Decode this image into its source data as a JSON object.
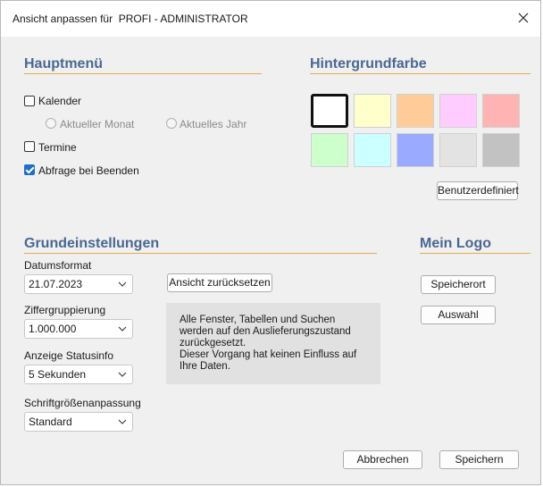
{
  "window": {
    "title": "Ansicht anpassen für  PROFI - ADMINISTRATOR"
  },
  "hauptmenu": {
    "title": "Hauptmenü",
    "kalender": {
      "label": "Kalender",
      "checked": false
    },
    "aktueller_monat": {
      "label": "Aktueller Monat"
    },
    "aktuelles_jahr": {
      "label": "Aktuelles Jahr"
    },
    "termine": {
      "label": "Termine",
      "checked": false
    },
    "abfrage": {
      "label": "Abfrage bei Beenden",
      "checked": true
    }
  },
  "hintergrund": {
    "title": "Hintergrundfarbe",
    "swatches": [
      "#ffffff",
      "#ffffcc",
      "#ffcc99",
      "#ffccff",
      "#ffb3b3",
      "#ccffcc",
      "#ccffff",
      "#99aaff",
      "#e3e3e3",
      "#c2c2c2"
    ],
    "selected_index": 0,
    "custom_button": "Benutzerdefiniert"
  },
  "grundeinstellungen": {
    "title": "Grundeinstellungen",
    "datumsformat": {
      "label": "Datumsformat",
      "value": "21.07.2023"
    },
    "ziffern": {
      "label": "Ziffergruppierung",
      "value": "1.000.000"
    },
    "status": {
      "label": "Anzeige Statusinfo",
      "value": "5 Sekunden"
    },
    "schrift": {
      "label": "Schriftgrößenanpassung",
      "value": "Standard"
    },
    "reset_button": "Ansicht zurücksetzen",
    "info_line1": "Alle Fenster, Tabellen und Suchen werden auf den Auslieferungszustand zurückgesetzt.",
    "info_line2": "Dieser Vorgang hat keinen Einfluss auf Ihre Daten."
  },
  "logo": {
    "title": "Mein Logo",
    "speicherort": "Speicherort",
    "auswahl": "Auswahl"
  },
  "footer": {
    "cancel": "Abbrechen",
    "save": "Speichern"
  },
  "colors": {
    "section_title": "#4a6792",
    "section_line": "#e8a94a",
    "checkbox_checked": "#1f6fc6"
  }
}
